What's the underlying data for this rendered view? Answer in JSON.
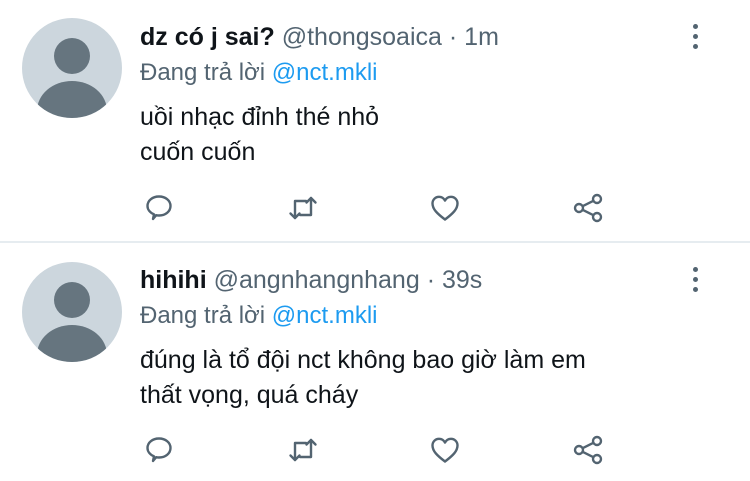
{
  "tweets": [
    {
      "display_name": "dz có j sai?",
      "handle": "@thongsoaica",
      "separator": "·",
      "time": "1m",
      "reply_prefix": "Đang trả lời",
      "reply_mention": "@nct.mkli",
      "lines": [
        "uồi nhạc đỉnh thé nhỏ",
        "cuốn cuốn"
      ]
    },
    {
      "display_name": "hihihi",
      "handle": "@angnhangnhang",
      "separator": "·",
      "time": "39s",
      "reply_prefix": "Đang trả lời",
      "reply_mention": "@nct.mkli",
      "lines": [
        "đúng là tổ đội nct không bao giờ làm em",
        "thất vọng, quá cháy"
      ]
    }
  ],
  "icons": [
    "comment-icon",
    "retweet-icon",
    "like-icon",
    "share-icon",
    "more-icon"
  ],
  "colors": {
    "mention": "#1d9bf0",
    "secondary_text": "#536471",
    "avatar_bg": "#ccd6dd"
  }
}
